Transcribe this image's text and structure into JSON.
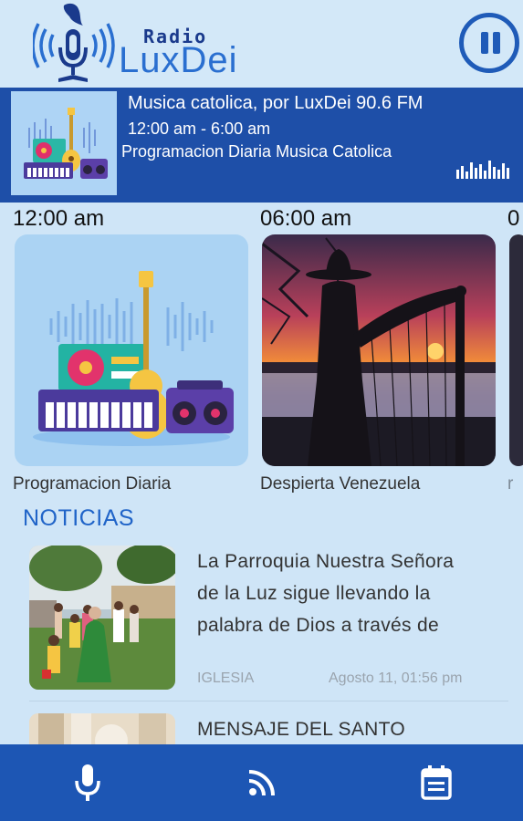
{
  "colors": {
    "brand_dark": "#1a3a8c",
    "brand_light": "#2a6fd0",
    "accent_blue": "#1e4fa8",
    "nav_blue": "#1d56b4",
    "background": "#cfe5f7",
    "section_heading": "#2064c8"
  },
  "header": {
    "brand_small": "Radio",
    "brand_big": "LuxDei",
    "logo_icon": "microphone-radio-logo-icon",
    "control_icon": "pause-icon"
  },
  "now_playing": {
    "title": "Musica catolica, por LuxDei 90.6 FM",
    "time": "12:00 am - 6:00 am",
    "subtitle": "Programacion Diaria  Musica Catolica",
    "thumb_icon": "music-instruments-icon",
    "equalizer_icon": "equalizer-icon"
  },
  "schedule": [
    {
      "time": "12:00 am",
      "label": "Programacion Diaria",
      "image": "music-instruments-illustration"
    },
    {
      "time": "06:00 am",
      "label": "Despierta  Venezuela",
      "image": "sunset-harp-player-photo"
    },
    {
      "time": "0",
      "label": "r",
      "image": "partial-card"
    }
  ],
  "news": {
    "heading": "NOTICIAS",
    "items": [
      {
        "text": "La Parroquia Nuestra Señora de la Luz  sigue llevando la palabra de Dios a través de",
        "lines": [
          "La Parroquia Nuestra Señora",
          "de la Luz  sigue llevando la",
          "palabra de Dios a través de"
        ],
        "category": "IGLESIA",
        "date": "Agosto 11, 01:56 pm",
        "image": "parish-outdoor-gathering-photo"
      },
      {
        "text": "MENSAJE DEL SANTO",
        "lines": [
          "MENSAJE DEL SANTO"
        ],
        "image": "message-photo"
      }
    ]
  },
  "bottom_nav": [
    {
      "icon": "microphone-icon"
    },
    {
      "icon": "rss-feed-icon"
    },
    {
      "icon": "calendar-icon"
    }
  ]
}
